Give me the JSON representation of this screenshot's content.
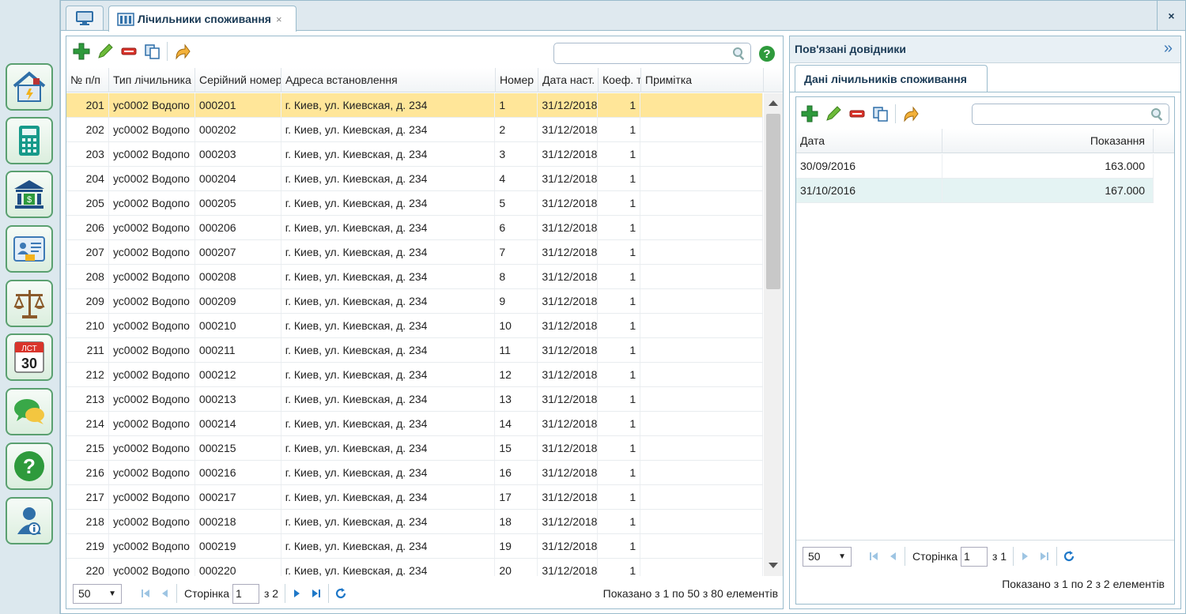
{
  "sidebar": {
    "items": [
      {
        "name": "utilities",
        "icon": "house-utilities-icon"
      },
      {
        "name": "calculator",
        "icon": "calculator-icon"
      },
      {
        "name": "bank",
        "icon": "bank-icon"
      },
      {
        "name": "contacts",
        "icon": "id-card-icon"
      },
      {
        "name": "scales",
        "icon": "scales-icon"
      },
      {
        "name": "calendar",
        "icon": "calendar-icon",
        "month": "ЛСТ",
        "day": "30"
      },
      {
        "name": "chat",
        "icon": "chat-icon"
      },
      {
        "name": "help",
        "icon": "help-icon",
        "glyph": "?"
      },
      {
        "name": "user-info",
        "icon": "user-info-icon"
      }
    ]
  },
  "tabs": {
    "active_label": "Лічильники споживання",
    "close_glyph": "×",
    "close_all_glyph": "×"
  },
  "left": {
    "help_glyph": "?",
    "columns": [
      "№ п/п",
      "Тип лічильника",
      "Серійний номер",
      "Адреса встановлення",
      "Номер",
      "Дата наст.",
      "Коеф. т",
      "Примітка"
    ],
    "rows": [
      [
        "201",
        "ус0002 Водопо",
        "000201",
        "г. Киев, ул. Киевская, д. 234",
        "1",
        "31/12/2018",
        "1",
        ""
      ],
      [
        "202",
        "ус0002 Водопо",
        "000202",
        "г. Киев, ул. Киевская, д. 234",
        "2",
        "31/12/2018",
        "1",
        ""
      ],
      [
        "203",
        "ус0002 Водопо",
        "000203",
        "г. Киев, ул. Киевская, д. 234",
        "3",
        "31/12/2018",
        "1",
        ""
      ],
      [
        "204",
        "ус0002 Водопо",
        "000204",
        "г. Киев, ул. Киевская, д. 234",
        "4",
        "31/12/2018",
        "1",
        ""
      ],
      [
        "205",
        "ус0002 Водопо",
        "000205",
        "г. Киев, ул. Киевская, д. 234",
        "5",
        "31/12/2018",
        "1",
        ""
      ],
      [
        "206",
        "ус0002 Водопо",
        "000206",
        "г. Киев, ул. Киевская, д. 234",
        "6",
        "31/12/2018",
        "1",
        ""
      ],
      [
        "207",
        "ус0002 Водопо",
        "000207",
        "г. Киев, ул. Киевская, д. 234",
        "7",
        "31/12/2018",
        "1",
        ""
      ],
      [
        "208",
        "ус0002 Водопо",
        "000208",
        "г. Киев, ул. Киевская, д. 234",
        "8",
        "31/12/2018",
        "1",
        ""
      ],
      [
        "209",
        "ус0002 Водопо",
        "000209",
        "г. Киев, ул. Киевская, д. 234",
        "9",
        "31/12/2018",
        "1",
        ""
      ],
      [
        "210",
        "ус0002 Водопо",
        "000210",
        "г. Киев, ул. Киевская, д. 234",
        "10",
        "31/12/2018",
        "1",
        ""
      ],
      [
        "211",
        "ус0002 Водопо",
        "000211",
        "г. Киев, ул. Киевская, д. 234",
        "11",
        "31/12/2018",
        "1",
        ""
      ],
      [
        "212",
        "ус0002 Водопо",
        "000212",
        "г. Киев, ул. Киевская, д. 234",
        "12",
        "31/12/2018",
        "1",
        ""
      ],
      [
        "213",
        "ус0002 Водопо",
        "000213",
        "г. Киев, ул. Киевская, д. 234",
        "13",
        "31/12/2018",
        "1",
        ""
      ],
      [
        "214",
        "ус0002 Водопо",
        "000214",
        "г. Киев, ул. Киевская, д. 234",
        "14",
        "31/12/2018",
        "1",
        ""
      ],
      [
        "215",
        "ус0002 Водопо",
        "000215",
        "г. Киев, ул. Киевская, д. 234",
        "15",
        "31/12/2018",
        "1",
        ""
      ],
      [
        "216",
        "ус0002 Водопо",
        "000216",
        "г. Киев, ул. Киевская, д. 234",
        "16",
        "31/12/2018",
        "1",
        ""
      ],
      [
        "217",
        "ус0002 Водопо",
        "000217",
        "г. Киев, ул. Киевская, д. 234",
        "17",
        "31/12/2018",
        "1",
        ""
      ],
      [
        "218",
        "ус0002 Водопо",
        "000218",
        "г. Киев, ул. Киевская, д. 234",
        "18",
        "31/12/2018",
        "1",
        ""
      ],
      [
        "219",
        "ус0002 Водопо",
        "000219",
        "г. Киев, ул. Киевская, д. 234",
        "19",
        "31/12/2018",
        "1",
        ""
      ],
      [
        "220",
        "ус0002 Водопо",
        "000220",
        "г. Киев, ул. Киевская, д. 234",
        "20",
        "31/12/2018",
        "1",
        ""
      ]
    ],
    "pager": {
      "page_size": "50",
      "page_label": "Сторінка",
      "page": "1",
      "of_label": "з 2",
      "summary": "Показано з 1 по 50 з 80 елементів"
    }
  },
  "right": {
    "title": "Пов'язані довідники",
    "collapse_glyph": "»",
    "tab_label": "Дані лічильників споживання",
    "columns": [
      "Дата",
      "Показання"
    ],
    "rows": [
      [
        "30/09/2016",
        "163.000"
      ],
      [
        "31/10/2016",
        "167.000"
      ]
    ],
    "pager": {
      "page_size": "50",
      "page_label": "Сторінка",
      "page": "1",
      "of_label": "з 1",
      "summary": "Показано з 1 по 2 з 2 елементів"
    }
  },
  "colors": {
    "selected_row": "#ffe699",
    "alt_row": "#e4f3f3",
    "accent": "#1a3a55"
  }
}
